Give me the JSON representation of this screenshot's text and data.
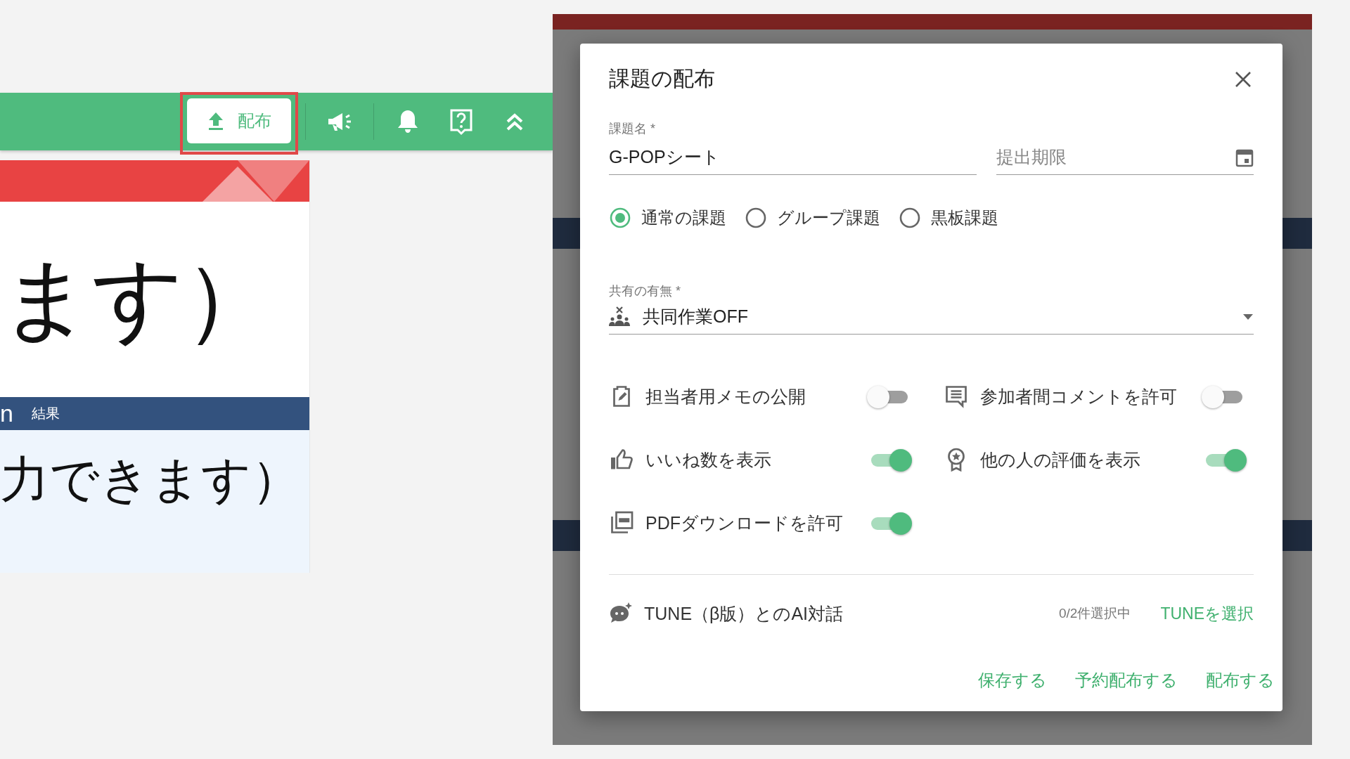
{
  "toolbar": {
    "distribute_button": {
      "label": "配布"
    }
  },
  "slide": {
    "heading": "ます）",
    "section_prefix": "n",
    "section_label": "結果",
    "body": "力できます）"
  },
  "dialog": {
    "title": "課題の配布",
    "name_field": {
      "label": "課題名 *",
      "value": "G-POPシート"
    },
    "due_field": {
      "placeholder": "提出期限"
    },
    "task_types": [
      {
        "label": "通常の課題",
        "selected": true
      },
      {
        "label": "グループ課題",
        "selected": false
      },
      {
        "label": "黒板課題",
        "selected": false
      }
    ],
    "share_select": {
      "label": "共有の有無 *",
      "value": "共同作業OFF"
    },
    "options": [
      {
        "kind": "memo",
        "label": "担当者用メモの公開",
        "on": false
      },
      {
        "kind": "comment",
        "label": "参加者間コメントを許可",
        "on": false
      },
      {
        "kind": "like",
        "label": "いいね数を表示",
        "on": true
      },
      {
        "kind": "rating",
        "label": "他の人の評価を表示",
        "on": true
      },
      {
        "kind": "pdf",
        "label": "PDFダウンロードを許可",
        "on": true
      }
    ],
    "tune": {
      "label": "TUNE（β版）とのAI対話",
      "count": "0/2件選択中",
      "link": "TUNEを選択"
    },
    "actions": [
      "保存する",
      "予約配布する",
      "配布する"
    ]
  }
}
